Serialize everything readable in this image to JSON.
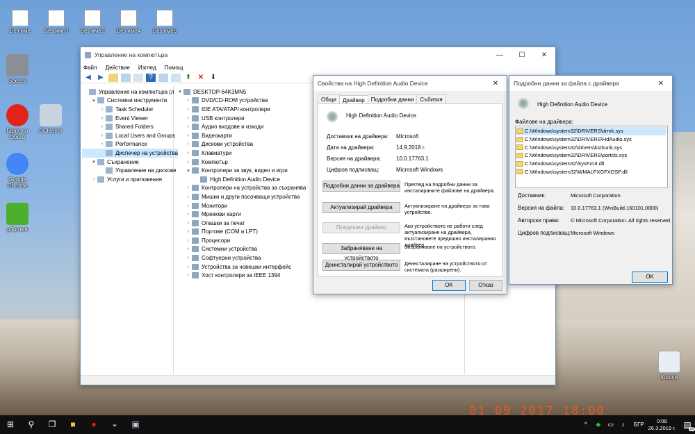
{
  "desktop": {
    "top_icons": [
      "Без име",
      "Без име3",
      "Без име2",
      "Без име4",
      "Без име5"
    ],
    "left_icons": [
      "Speccy",
      "Браузър Opera",
      "CCleaner",
      "Google Chrome",
      "µTorrent"
    ],
    "recycle_label": "Кошче",
    "date_watermark": "01 09 2017 18:00"
  },
  "mmc": {
    "title": "Управление на компютъра",
    "menu": [
      "Файл",
      "Действие",
      "Изглед",
      "Помощ"
    ],
    "left_tree": [
      {
        "label": "Управление на компютъра (л",
        "indent": 0,
        "arrow": ""
      },
      {
        "label": "Системни инструменти",
        "indent": 1,
        "arrow": "▾"
      },
      {
        "label": "Task Scheduler",
        "indent": 2,
        "arrow": "›"
      },
      {
        "label": "Event Viewer",
        "indent": 2,
        "arrow": "›"
      },
      {
        "label": "Shared Folders",
        "indent": 2,
        "arrow": "›"
      },
      {
        "label": "Local Users and Groups",
        "indent": 2,
        "arrow": "›"
      },
      {
        "label": "Performance",
        "indent": 2,
        "arrow": "›"
      },
      {
        "label": "Диспечер на устройства",
        "indent": 2,
        "arrow": "",
        "selected": true
      },
      {
        "label": "Съхранение",
        "indent": 1,
        "arrow": "▾"
      },
      {
        "label": "Управление на дискове",
        "indent": 2,
        "arrow": ""
      },
      {
        "label": "Услуги и приложения",
        "indent": 1,
        "arrow": "›"
      }
    ],
    "device_tree": [
      {
        "label": "DESKTOP-64K3MN5",
        "indent": 0,
        "arrow": "▾"
      },
      {
        "label": "DVD/CD-ROM устройства",
        "indent": 1,
        "arrow": "›"
      },
      {
        "label": "IDE ATA/ATAPI контролери",
        "indent": 1,
        "arrow": "›"
      },
      {
        "label": "USB контролери",
        "indent": 1,
        "arrow": "›"
      },
      {
        "label": "Аудио входове и изходи",
        "indent": 1,
        "arrow": "›"
      },
      {
        "label": "Видеокарти",
        "indent": 1,
        "arrow": "›"
      },
      {
        "label": "Дискови устройства",
        "indent": 1,
        "arrow": "›"
      },
      {
        "label": "Клавиатури",
        "indent": 1,
        "arrow": "›"
      },
      {
        "label": "Компютър",
        "indent": 1,
        "arrow": "›"
      },
      {
        "label": "Контролери за звук, видео и игри",
        "indent": 1,
        "arrow": "▾"
      },
      {
        "label": "High Definition Audio Device",
        "indent": 2,
        "arrow": ""
      },
      {
        "label": "Контролери на устройства за съхранява",
        "indent": 1,
        "arrow": "›"
      },
      {
        "label": "Мишки и други посочващи устройства",
        "indent": 1,
        "arrow": "›"
      },
      {
        "label": "Монитори",
        "indent": 1,
        "arrow": "›"
      },
      {
        "label": "Мрежови карти",
        "indent": 1,
        "arrow": "›"
      },
      {
        "label": "Опашки за печат",
        "indent": 1,
        "arrow": "›"
      },
      {
        "label": "Портове (COM и LPT)",
        "indent": 1,
        "arrow": "›"
      },
      {
        "label": "Процесори",
        "indent": 1,
        "arrow": "›"
      },
      {
        "label": "Системни устройства",
        "indent": 1,
        "arrow": "›"
      },
      {
        "label": "Софтуерни устройства",
        "indent": 1,
        "arrow": "›"
      },
      {
        "label": "Устройства за човешки интерфейс",
        "indent": 1,
        "arrow": "›"
      },
      {
        "label": "Хост контролери за IEEE 1394",
        "indent": 1,
        "arrow": "›"
      }
    ]
  },
  "props": {
    "title": "Свойства на High Definition Audio Device",
    "tabs": [
      "Общи",
      "Драйвер",
      "Подробни данни",
      "Събития"
    ],
    "active_tab": 1,
    "device_name": "High Definition Audio Device",
    "fields": [
      {
        "label": "Доставчик на драйвера:",
        "value": "Microsoft"
      },
      {
        "label": "Дата на драйвера:",
        "value": "14.9.2018 г."
      },
      {
        "label": "Версия на драйвера:",
        "value": "10.0.17763.1"
      },
      {
        "label": "Цифров подписващ:",
        "value": "Microsoft Windows"
      }
    ],
    "actions": [
      {
        "button": "Подробни данни за драйвера",
        "desc": "Преглед на подробни данни за инсталираните файлове на драйвера.",
        "disabled": false
      },
      {
        "button": "Актуализирай драйвера",
        "desc": "Актуализиране на драйвера за това устройство.",
        "disabled": false
      },
      {
        "button": "Предишен драйвер",
        "desc": "Ако устройството не работи след актуализиране на драйвера, възстановете предишно инсталирания драйвер.",
        "disabled": true
      },
      {
        "button": "Забраняване на устройството",
        "desc": "Забраняване на устройството.",
        "disabled": false
      },
      {
        "button": "Деинсталирай устройството",
        "desc": "Деинсталиране на устройството от системата (разширени).",
        "disabled": false
      }
    ],
    "ok": "OK",
    "cancel": "Отказ"
  },
  "details": {
    "title": "Подробни данни за файла с драйвера",
    "device_name": "High Definition Audio Device",
    "files_label": "Файлове на драйвера:",
    "files": [
      "C:\\Windows\\system32\\DRIVERS\\drmk.sys",
      "C:\\Windows\\system32\\DRIVERS\\HdAudio.sys",
      "C:\\Windows\\system32\\drivers\\ksthunk.sys",
      "C:\\Windows\\system32\\DRIVERS\\portcls.sys",
      "C:\\Windows\\system32\\SysFxUI.dll",
      "C:\\Windows\\system32\\WMALFXGFXDSP.dll"
    ],
    "fields": [
      {
        "label": "Доставчик:",
        "value": "Microsoft Corporation"
      },
      {
        "label": "Версия на файла:",
        "value": "10.0.17763.1 (WinBuild.160101.0800)"
      },
      {
        "label": "Авторски права:",
        "value": "© Microsoft Corporation. All rights reserved."
      },
      {
        "label": "Цифров подписващ:",
        "value": "Microsoft Windows"
      }
    ],
    "ok": "OK"
  },
  "taskbar": {
    "lang": "БГР",
    "time": "0:08",
    "date": "26.3.2019 г.",
    "notif_count": "10"
  },
  "colors": {
    "accent": "#0078d7",
    "taskbar": "#101010",
    "selection": "#cce8ff"
  }
}
